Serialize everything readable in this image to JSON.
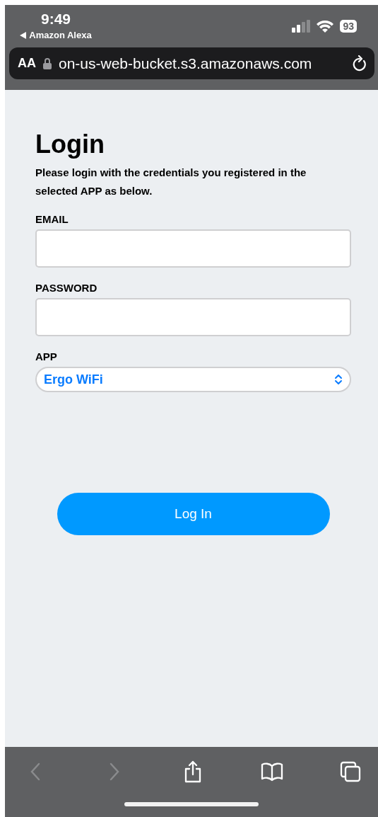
{
  "status_bar": {
    "time": "9:49",
    "back_app": "Amazon Alexa",
    "battery": "93"
  },
  "address_bar": {
    "text_size": "AA",
    "url": "on-us-web-bucket.s3.amazonaws.com"
  },
  "page": {
    "title": "Login",
    "subtitle": "Please login with the credentials you registered in the selected APP as below.",
    "fields": [
      {
        "kind": "text",
        "label": "EMAIL"
      },
      {
        "kind": "password",
        "label": "PASSWORD"
      },
      {
        "kind": "select",
        "label": "APP",
        "value": "Ergo WiFi"
      }
    ],
    "submit": "Log In"
  },
  "toolbar": [
    {
      "kind": "back",
      "disabled": true
    },
    {
      "kind": "forward",
      "disabled": true
    },
    {
      "kind": "share",
      "disabled": false
    },
    {
      "kind": "bookmarks",
      "disabled": false
    },
    {
      "kind": "tabs",
      "disabled": false
    }
  ]
}
